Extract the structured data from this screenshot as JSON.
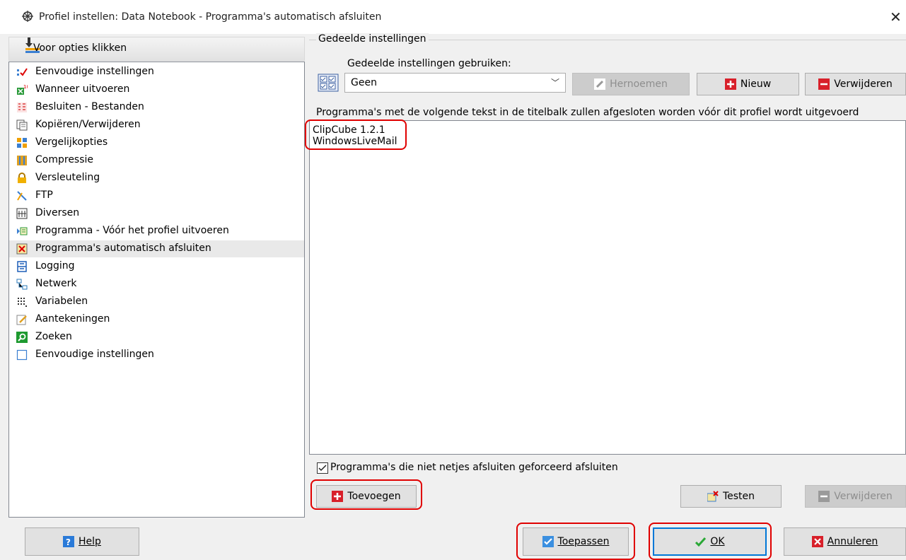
{
  "window": {
    "title": "Profiel instellen: Data Notebook - Programma's automatisch afsluiten",
    "close_icon": "close-icon"
  },
  "left_panel": {
    "header": "Voor opties klikken",
    "items": [
      {
        "label": "Eenvoudige instellingen",
        "icon": "simple-settings-icon"
      },
      {
        "label": "Wanneer uitvoeren",
        "icon": "schedule-icon"
      },
      {
        "label": "Besluiten - Bestanden",
        "icon": "file-filter-icon"
      },
      {
        "label": "Kopiëren/Verwijderen",
        "icon": "copy-delete-icon"
      },
      {
        "label": "Vergelijkopties",
        "icon": "compare-icon"
      },
      {
        "label": "Compressie",
        "icon": "compression-icon"
      },
      {
        "label": "Versleuteling",
        "icon": "lock-icon"
      },
      {
        "label": "FTP",
        "icon": "ftp-icon"
      },
      {
        "label": "Diversen",
        "icon": "misc-icon"
      },
      {
        "label": "Programma - Vóór het profiel uitvoeren",
        "icon": "run-program-icon"
      },
      {
        "label": "Programma's automatisch afsluiten",
        "icon": "close-program-icon",
        "selected": true
      },
      {
        "label": "Logging",
        "icon": "logging-icon"
      },
      {
        "label": "Netwerk",
        "icon": "network-icon"
      },
      {
        "label": "Variabelen",
        "icon": "variables-icon"
      },
      {
        "label": "Aantekeningen",
        "icon": "notes-icon"
      },
      {
        "label": "Zoeken",
        "icon": "search-icon"
      },
      {
        "label": "Eenvoudige instellingen",
        "icon": "simple-settings-icon"
      }
    ]
  },
  "shared": {
    "group_title": "Gedeelde instellingen",
    "use_label": "Gedeelde instellingen gebruiken:",
    "select_value": "Geen",
    "rename_label": "Hernoemen",
    "new_label": "Nieuw",
    "delete_label": "Verwijderen"
  },
  "programs": {
    "label": "Programma's met de volgende tekst in de titelbalk zullen afgesloten worden vóór dit profiel wordt uitgevoerd",
    "items": [
      "ClipCube 1.2.1",
      "WindowsLiveMail"
    ],
    "force_close_label": "Programma's die niet netjes afsluiten geforceerd afsluiten",
    "force_close_checked": true,
    "add_label": "Toevoegen",
    "test_label": "Testen",
    "remove_label": "Verwijderen"
  },
  "footer": {
    "help_label": "Help",
    "apply_label": "Toepassen",
    "ok_label": "OK",
    "cancel_label": "Annuleren"
  },
  "colors": {
    "annotation": "#e00000",
    "selected_row": "#e9e9e9",
    "ok_border": "#0078d7"
  }
}
